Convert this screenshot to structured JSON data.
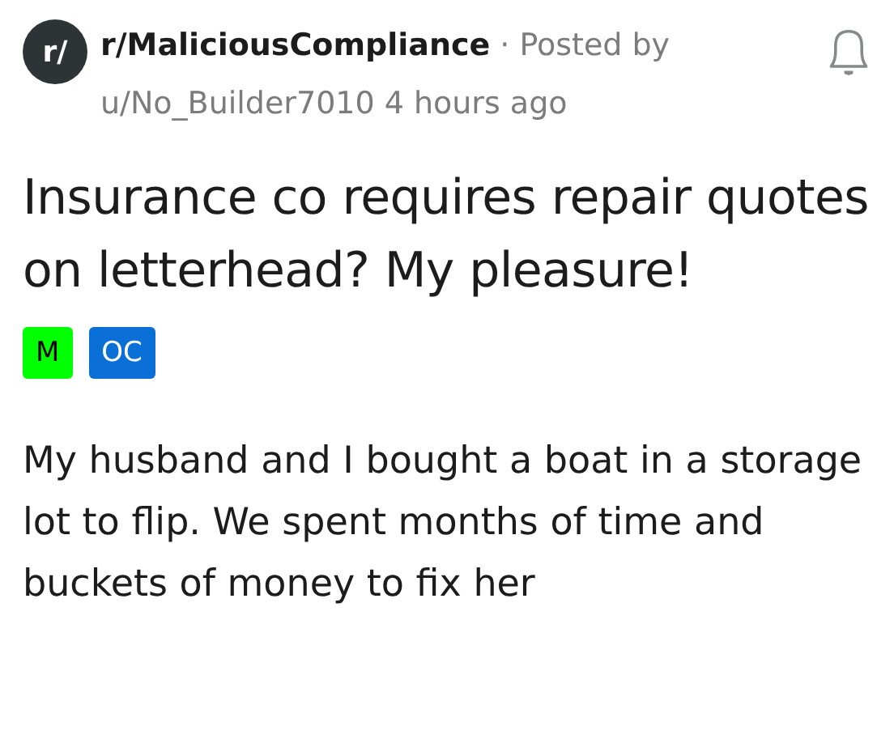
{
  "header": {
    "community_icon": "r/",
    "community": "r/MaliciousCompliance",
    "separator": "·",
    "posted_by": "Posted by",
    "author": "u/No_Builder7010",
    "time": "4 hours ago"
  },
  "title": "Insurance co requires repair quotes on letterhead? My pleasure!",
  "flairs": [
    {
      "label": "M",
      "color": "#00ff00"
    },
    {
      "label": "OC",
      "color": "#0a6fd6"
    }
  ],
  "body": "My husband and I bought a boat in a storage lot to flip. We spent months of time and buckets of money to fix her"
}
